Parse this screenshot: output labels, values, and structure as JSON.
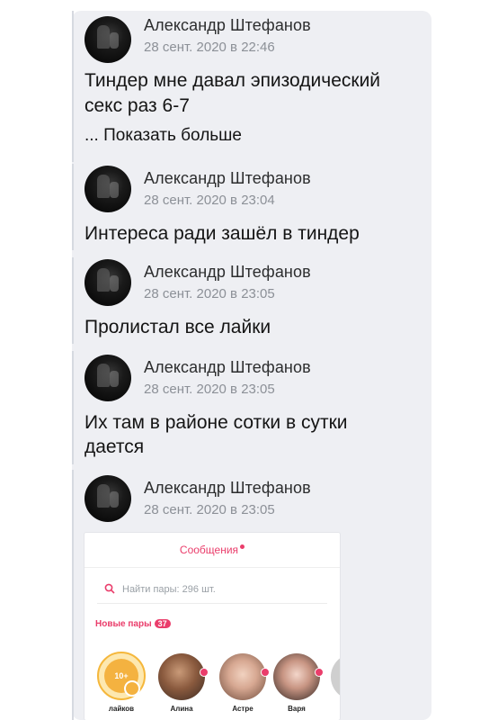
{
  "posts": [
    {
      "author": "Александр Штефанов",
      "date": "28 сент. 2020 в 22:46",
      "lines": [
        "Тиндер мне давал эпизодический",
        "секс раз 6-7"
      ],
      "show_more": "... Показать больше"
    },
    {
      "author": "Александр Штефанов",
      "date": "28 сент. 2020 в 23:04",
      "lines": [
        "Интереса ради зашёл в тиндер"
      ]
    },
    {
      "author": "Александр Штефанов",
      "date": "28 сент. 2020 в 23:05",
      "lines": [
        "Пролистал все лайки"
      ]
    },
    {
      "author": "Александр Штефанов",
      "date": "28 сент. 2020 в 23:05",
      "lines": [
        "Их там в районе сотки в сутки",
        "дается"
      ]
    },
    {
      "author": "Александр Штефанов",
      "date": "28 сент. 2020 в 23:05",
      "lines": []
    }
  ],
  "attachment": {
    "title": "Сообщения",
    "search_placeholder": "Найти пары: 296 шт.",
    "new_pairs_label": "Новые пары",
    "new_pairs_count": "37",
    "likes_badge": "10+",
    "matches": [
      {
        "name": "лайков"
      },
      {
        "name": "Алина"
      },
      {
        "name": "Астре"
      },
      {
        "name": "Варя"
      }
    ],
    "colors": {
      "accent": "#ea3d6b",
      "likes": "#f4b240"
    }
  }
}
